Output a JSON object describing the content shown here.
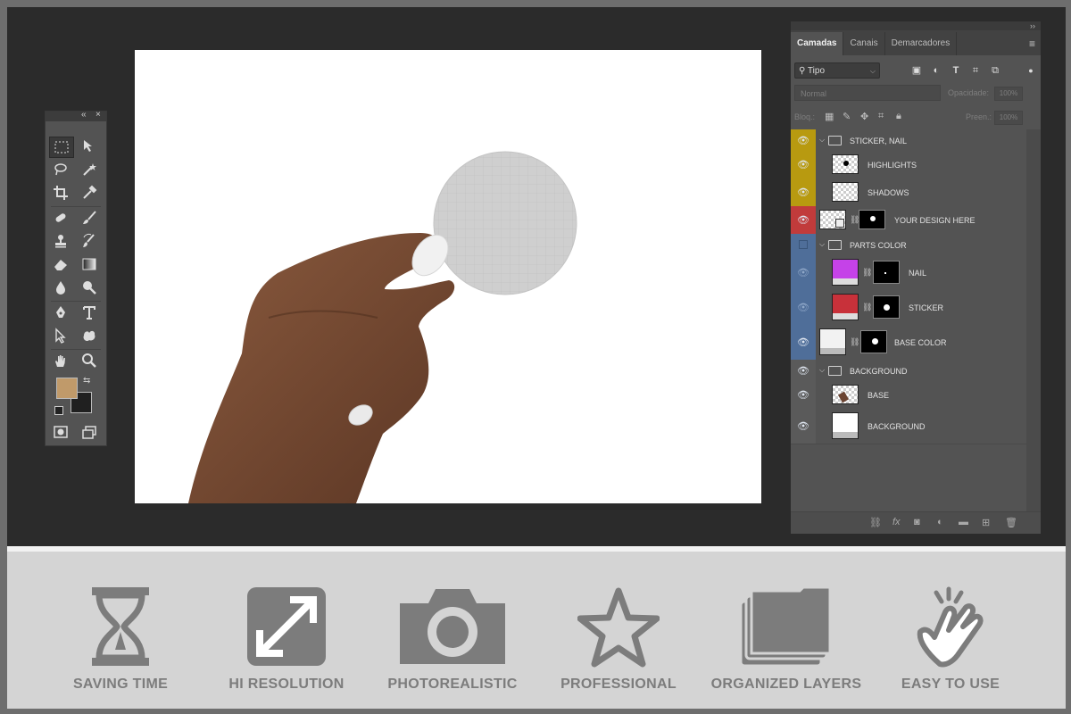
{
  "layers_panel": {
    "tabs": [
      "Camadas",
      "Canais",
      "Demarcadores"
    ],
    "kind_filter": "Tipo",
    "blend_mode": "Normal",
    "opacity_label": "Opacidade:",
    "opacity_value": "100%",
    "lock_label": "Bloq.:",
    "fill_label": "Preen.:",
    "fill_value": "100%",
    "layers": [
      {
        "name": "STICKER, NAIL",
        "kind": "group",
        "label_color": "#b89a10"
      },
      {
        "name": "HIGHLIGHTS",
        "kind": "layer",
        "label_color": "#b89a10"
      },
      {
        "name": "SHADOWS",
        "kind": "layer",
        "label_color": "#b89a10"
      },
      {
        "name": "YOUR DESIGN HERE",
        "kind": "smart-object",
        "label_color": "#c13b3b"
      },
      {
        "name": "PARTS COLOR",
        "kind": "group",
        "label_color": "#4f6e99"
      },
      {
        "name": "NAIL",
        "kind": "fill-layer",
        "label_color": "#4f6e99",
        "fill": "#c542e8"
      },
      {
        "name": "STICKER",
        "kind": "fill-layer",
        "label_color": "#4f6e99",
        "fill": "#c8313a"
      },
      {
        "name": "BASE COLOR",
        "kind": "fill-layer",
        "label_color": "#4f6e99",
        "fill": "#f2f2f2"
      },
      {
        "name": "BACKGROUND",
        "kind": "group",
        "label_color": "#5a5a5a"
      },
      {
        "name": "BASE",
        "kind": "layer",
        "label_color": "#5a5a5a"
      },
      {
        "name": "BACKGROUND",
        "kind": "fill-layer",
        "label_color": "#5a5a5a",
        "fill": "#ffffff"
      }
    ]
  },
  "tools_panel": {
    "foreground_color": "#c09a6a",
    "background_color": "#202020"
  },
  "features": [
    {
      "label": "SAVING TIME",
      "icon": "hourglass-icon"
    },
    {
      "label": "HI RESOLUTION",
      "icon": "expand-icon"
    },
    {
      "label": "PHOTOREALISTIC",
      "icon": "camera-icon"
    },
    {
      "label": "PROFESSIONAL",
      "icon": "star-icon"
    },
    {
      "label": "ORGANIZED LAYERS",
      "icon": "folders-icon"
    },
    {
      "label": "EASY TO USE",
      "icon": "hand-tap-icon"
    }
  ]
}
